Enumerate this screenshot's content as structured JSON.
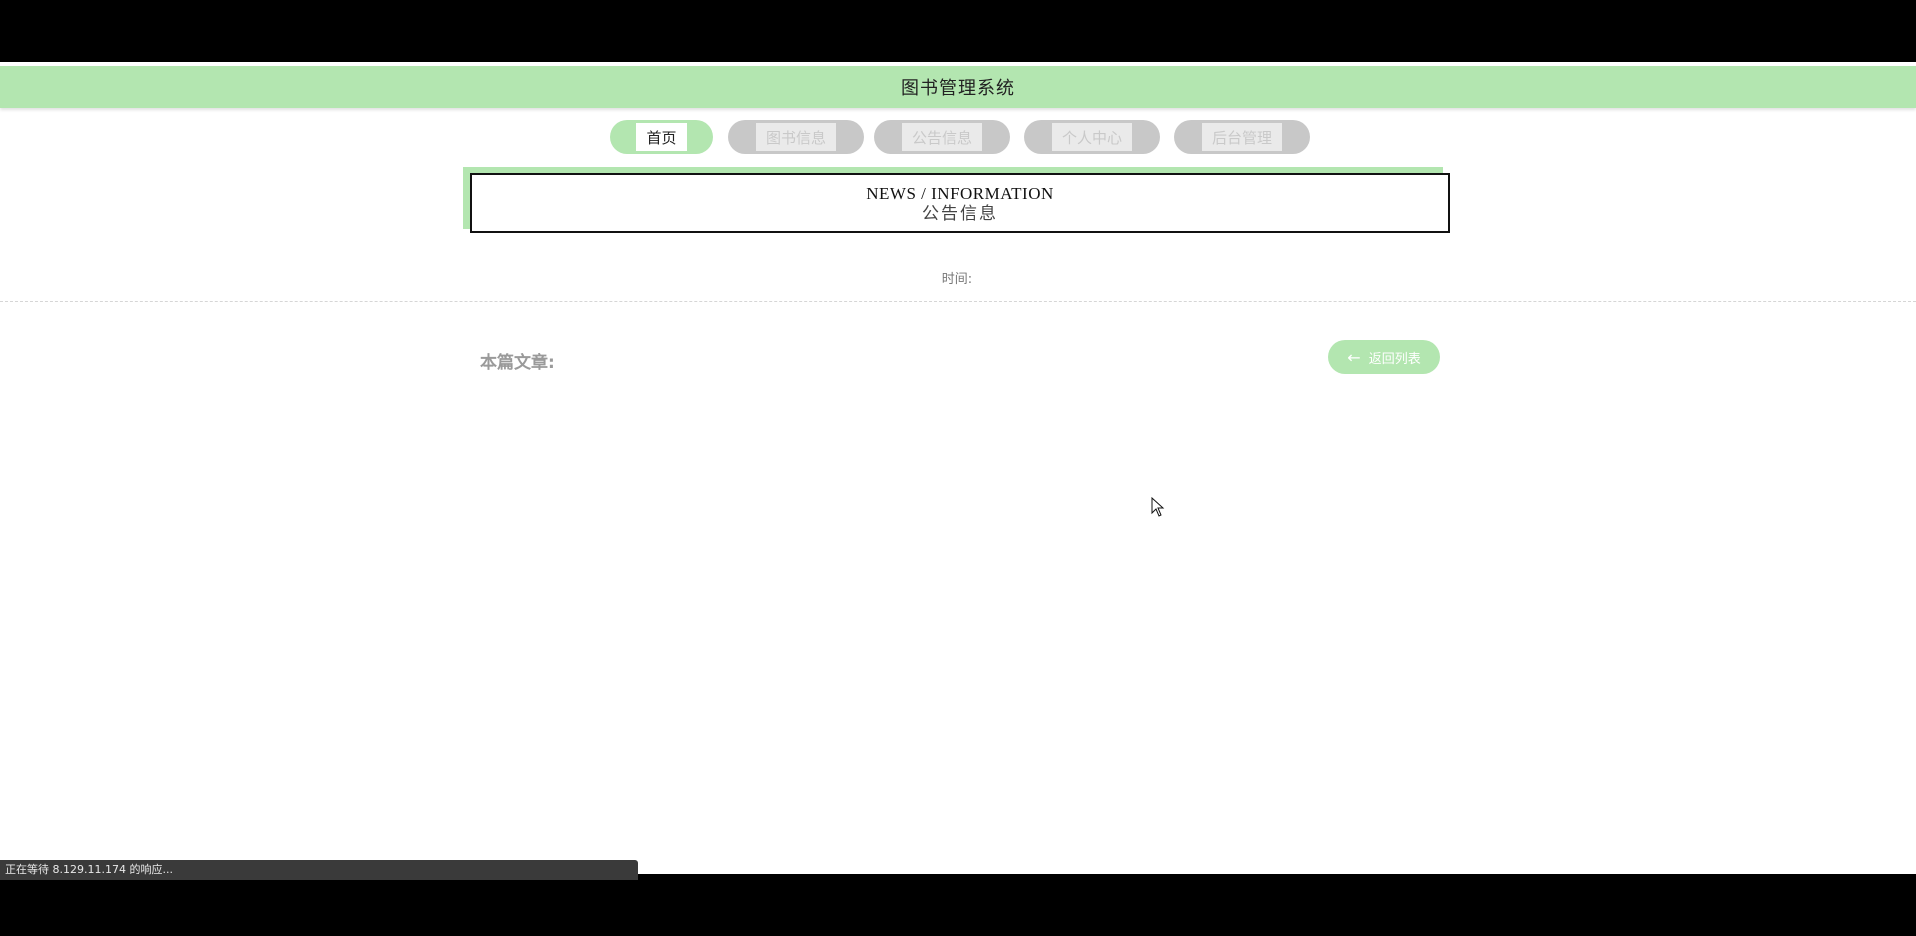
{
  "site": {
    "title": "图书管理系统",
    "accent_color": "#b3e6b0"
  },
  "nav": {
    "items": [
      {
        "label": "首页",
        "active": true
      },
      {
        "label": "图书信息",
        "active": false
      },
      {
        "label": "公告信息",
        "active": false
      },
      {
        "label": "个人中心",
        "active": false
      },
      {
        "label": "后台管理",
        "active": false
      }
    ]
  },
  "news_header": {
    "title_en": "NEWS / INFORMATION",
    "title_cn": "公告信息"
  },
  "detail": {
    "time_label": "时间:",
    "time_value": "",
    "article_label": "本篇文章:",
    "back_button_label": "返回列表",
    "back_icon": "arrow-left-icon"
  },
  "browser": {
    "status_text": "正在等待 8.129.11.174 的响应..."
  }
}
